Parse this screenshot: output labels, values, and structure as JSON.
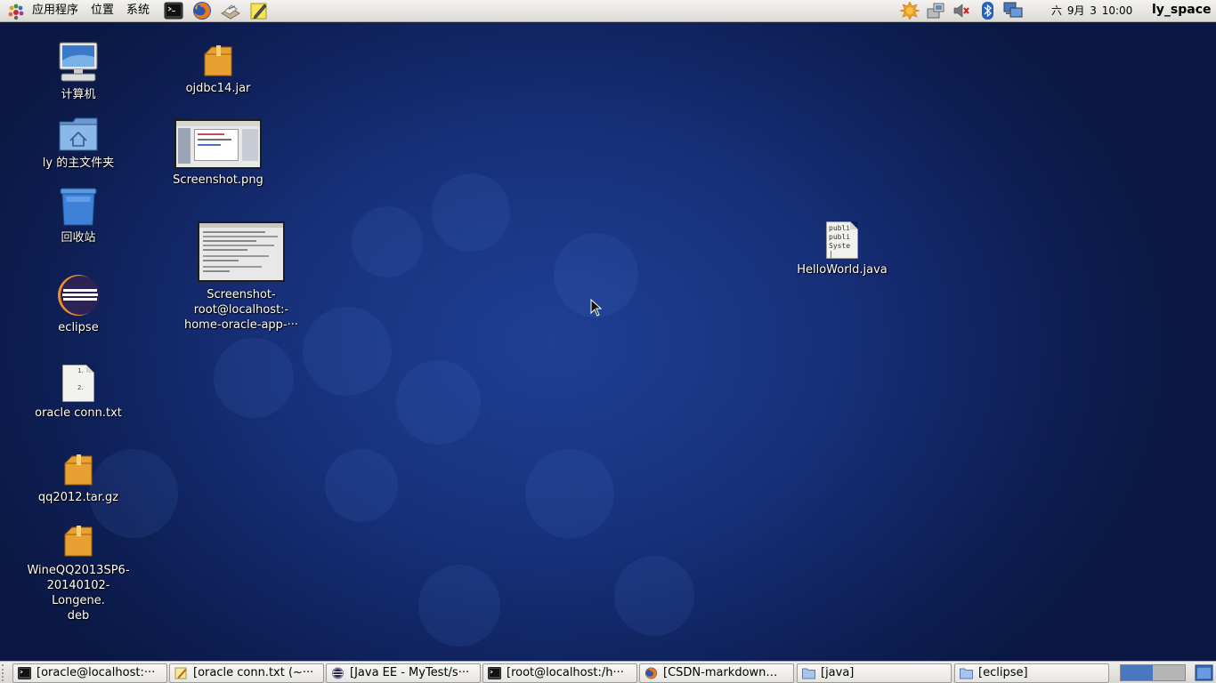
{
  "top_panel": {
    "menus": [
      "应用程序",
      "位置",
      "系统"
    ],
    "launchers": [
      "terminal-icon",
      "firefox-icon",
      "file-manager-icon",
      "text-editor-icon"
    ],
    "tray_icons": [
      "update-notifier-icon",
      "network-icon",
      "volume-muted-icon",
      "bluetooth-icon",
      "network-connections-icon"
    ],
    "clock": "六 9月 3 10:00",
    "username": "ly_space"
  },
  "desktop": {
    "icons": [
      {
        "label": "计算机",
        "icon": "computer-icon"
      },
      {
        "label": "ly 的主文件夹",
        "icon": "home-folder-icon"
      },
      {
        "label": "回收站",
        "icon": "trash-icon"
      },
      {
        "label": "eclipse",
        "icon": "eclipse-icon"
      },
      {
        "label": "oracle conn.txt",
        "icon": "text-file-icon",
        "preview": [
          "1.",
          "2."
        ]
      },
      {
        "label": "qq2012.tar.gz",
        "icon": "archive-icon"
      },
      {
        "label_lines": [
          "WineQQ2013SP6-",
          "20140102-Longene.",
          "deb"
        ],
        "icon": "archive-icon"
      },
      {
        "label": "ojdbc14.jar",
        "icon": "jar-archive-icon"
      },
      {
        "label": "Screenshot.png",
        "icon": "image-thumbnail-icon"
      },
      {
        "label_lines": [
          "Screenshot-",
          "root@localhost:-",
          "home-oracle-app-···"
        ],
        "icon": "image-thumbnail-icon"
      },
      {
        "label": "HelloWorld.java",
        "icon": "java-file-icon",
        "preview": [
          "publi",
          "publi",
          "Syste",
          "|"
        ]
      }
    ]
  },
  "taskbar": {
    "tasks": [
      {
        "label": "[oracle@localhost:···",
        "icon": "terminal-icon"
      },
      {
        "label": "[oracle conn.txt (~···",
        "icon": "text-editor-icon"
      },
      {
        "label": "[Java EE - MyTest/s···",
        "icon": "eclipse-icon"
      },
      {
        "label": "[root@localhost:/h···",
        "icon": "terminal-icon"
      },
      {
        "label": "[CSDN-markdown…",
        "icon": "firefox-icon"
      },
      {
        "label": "[java]",
        "icon": "folder-icon"
      },
      {
        "label": "[eclipse]",
        "icon": "folder-icon"
      }
    ],
    "workspace_colors": {
      "active": "#4a78c0",
      "inactive": "#b5b5b5"
    }
  }
}
